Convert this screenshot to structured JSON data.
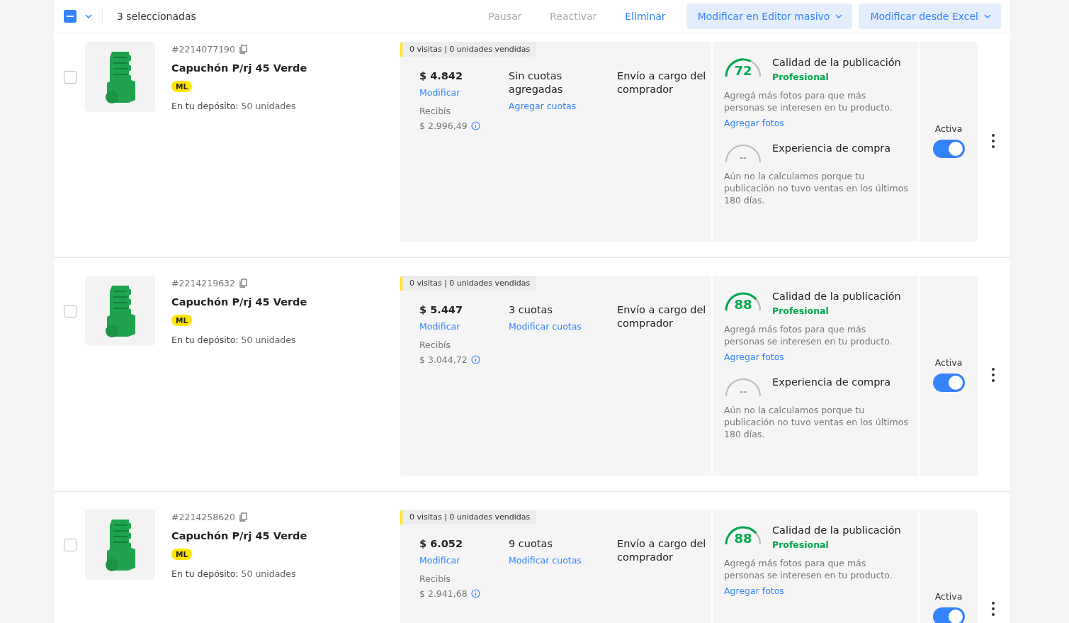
{
  "toolbar": {
    "select_all": {
      "partial": true
    },
    "selected_count": "3 seleccionadas",
    "actions": [
      {
        "label": "Pausar",
        "kind": "text",
        "disabled": true
      },
      {
        "label": "Reactivar",
        "kind": "text",
        "disabled": true
      },
      {
        "label": "Eliminar",
        "kind": "text",
        "disabled": false
      },
      {
        "label": "Modificar en Editor masivo",
        "kind": "dropdown",
        "disabled": false
      },
      {
        "label": "Modificar desde Excel",
        "kind": "dropdown",
        "disabled": false
      }
    ]
  },
  "listings": [
    {
      "checked": false,
      "id": "#2214077190",
      "title": "Capuchón P/rj 45 Verde",
      "badge": "ML",
      "stock": "**En tu depósito:** 50 unidades",
      "stats": "0 visitas | 0 unidades vendidas",
      "price": "$ 4.842",
      "price_link": "Modificar",
      "receive_label": "Recibís",
      "receive": "$ 2.996,49",
      "installments": "Sin cuotas agregadas",
      "installments_link": "Agregar cuotas",
      "shipping": "Envío a cargo del comprador",
      "quality": {
        "score": "72",
        "level": 0.72,
        "title": "Calidad de la publicación",
        "grade": "Profesional",
        "tip": "Agregá más fotos para que más personas se interesen en tu producto.",
        "link": "Agregar fotos"
      },
      "experience": {
        "score": "--",
        "title": "Experiencia de compra",
        "text": "Aún no la calculamos porque tu publicación no tuvo ventas en los últimos 180 días."
      },
      "status": "Activa",
      "on": true
    },
    {
      "checked": false,
      "id": "#2214219632",
      "title": "Capuchón P/rj 45 Verde",
      "badge": "ML",
      "stock": "**En tu depósito:** 50 unidades",
      "stats": "0 visitas | 0 unidades vendidas",
      "price": "$ 5.447",
      "price_link": "Modificar",
      "receive_label": "Recibís",
      "receive": "$ 3.044,72",
      "installments": "3 cuotas",
      "installments_link": "Modificar cuotas",
      "shipping": "Envío a cargo del comprador",
      "quality": {
        "score": "88",
        "level": 0.88,
        "title": "Calidad de la publicación",
        "grade": "Profesional",
        "tip": "Agregá más fotos para que más personas se interesen en tu producto.",
        "link": "Agregar fotos"
      },
      "experience": {
        "score": "--",
        "title": "Experiencia de compra",
        "text": "Aún no la calculamos porque tu publicación no tuvo ventas en los últimos 180 días."
      },
      "status": "Activa",
      "on": true
    },
    {
      "checked": false,
      "id": "#2214258620",
      "title": "Capuchón P/rj 45 Verde",
      "badge": "ML",
      "stock": "**En tu depósito:** 50 unidades",
      "stats": "0 visitas | 0 unidades vendidas",
      "price": "$ 6.052",
      "price_link": "Modificar",
      "receive_label": "Recibís",
      "receive": "$ 2.941,68",
      "installments": "9 cuotas",
      "installments_link": "Modificar cuotas",
      "shipping": "Envío a cargo del comprador",
      "quality": {
        "score": "88",
        "level": 0.88,
        "title": "Calidad de la publicación",
        "grade": "Profesional",
        "tip": "Agregá más fotos para que más personas se interesen en tu producto.",
        "link": "Agregar fotos"
      },
      "status": "Activa",
      "on": true
    }
  ]
}
